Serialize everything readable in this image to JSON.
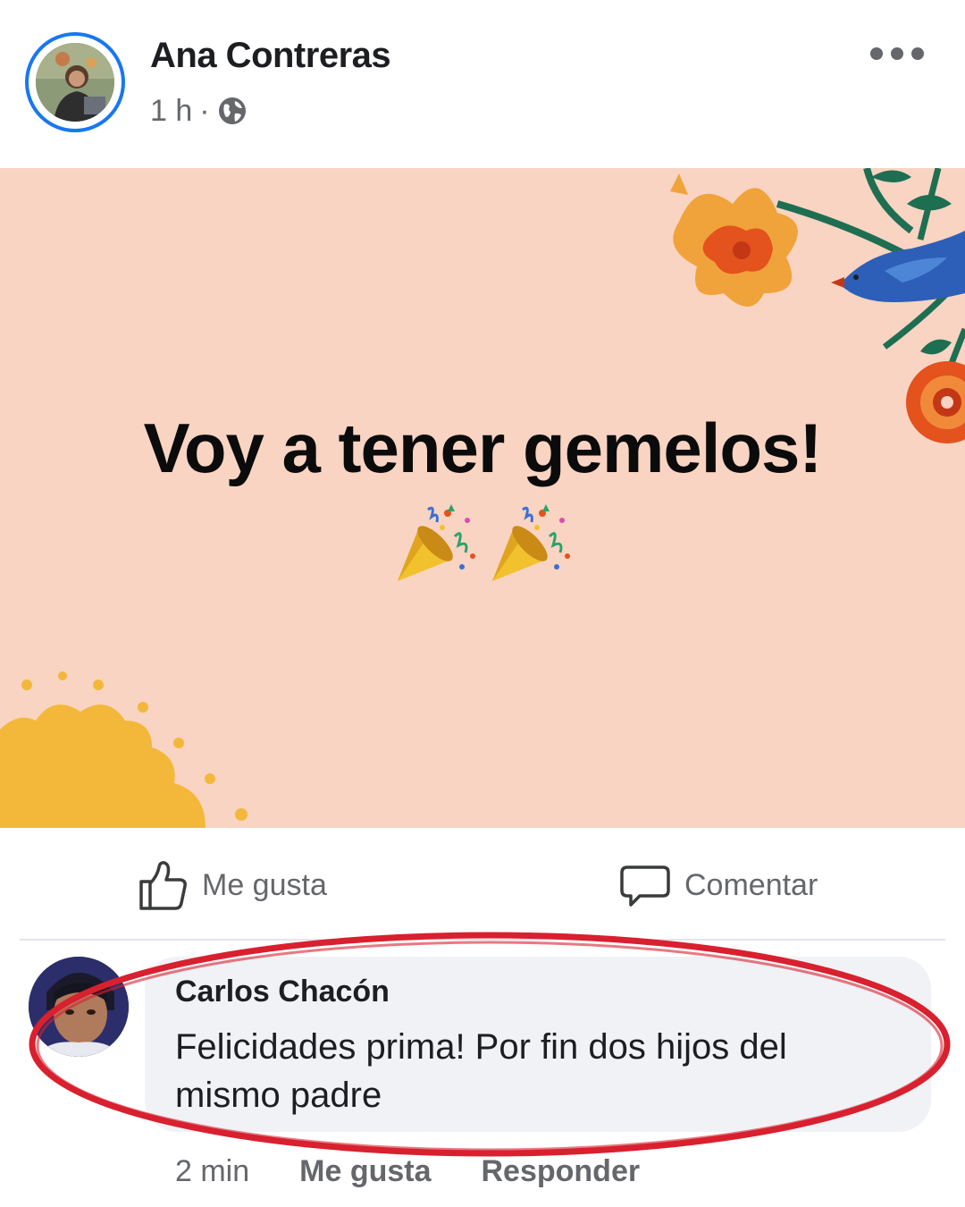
{
  "post": {
    "author": "Ana Contreras",
    "time": "1 h",
    "separator": "·",
    "privacy_icon": "globe-icon",
    "more_icon": "more-options-icon",
    "card_text": "Voy a tener gemelos!",
    "card_emoji": "party-popper-icon",
    "card_emoji_count": 2,
    "card_background": "#f9d4c2"
  },
  "actions": {
    "like_label": "Me gusta",
    "like_icon": "thumbs-up-icon",
    "comment_label": "Comentar",
    "comment_icon": "comment-bubble-icon"
  },
  "comment": {
    "author": "Carlos Chacón",
    "text": "Felicidades prima! Por fin dos hijos del mismo padre",
    "time": "2 min",
    "like_label": "Me gusta",
    "reply_label": "Responder"
  },
  "colors": {
    "accent": "#1877f2",
    "highlight": "#d8202e",
    "secondary_text": "#65676b"
  }
}
